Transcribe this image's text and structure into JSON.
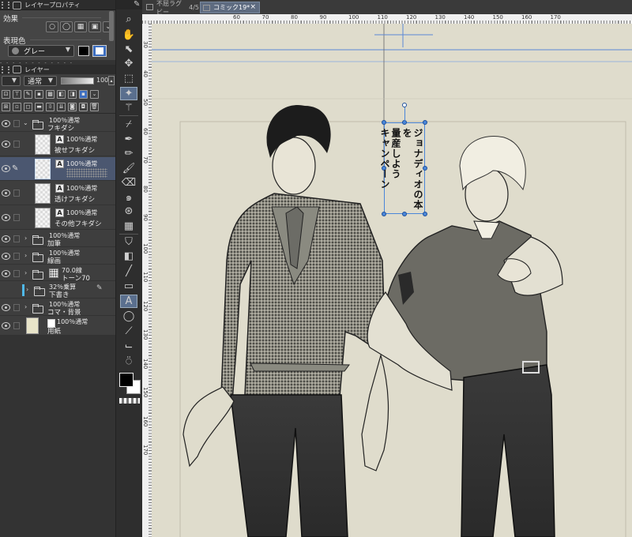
{
  "colors": {
    "accent": "#4a86d9",
    "canvas_bg": "#dfdccc",
    "panel_bg": "#3e3e3e",
    "selected_row": "#4b5770"
  },
  "property_panel": {
    "tab_title": "レイヤープロパティ",
    "effect_label": "効果",
    "expression_color_label": "表現色",
    "expression_color_value": "グレー"
  },
  "layer_panel": {
    "tab_title": "レイヤー",
    "blend_mode": "通常",
    "opacity": "100",
    "layers": [
      {
        "kind": "folder",
        "line1": "100％通常",
        "line2": "フキダシ",
        "expanded": true,
        "indent": 0
      },
      {
        "kind": "text",
        "line1": "100％通常",
        "line2": "被せフキダシ",
        "indent": 1
      },
      {
        "kind": "text",
        "line1": "100％通常",
        "line2": "",
        "indent": 1,
        "selected": true
      },
      {
        "kind": "text",
        "line1": "100％通常",
        "line2": "透けフキダシ",
        "indent": 1
      },
      {
        "kind": "text",
        "line1": "100％通常",
        "line2": "その他フキダシ",
        "indent": 1
      },
      {
        "kind": "folder",
        "line1": "100％通常",
        "line2": "加筆",
        "indent": 0
      },
      {
        "kind": "folder",
        "line1": "100％通常",
        "line2": "線画",
        "indent": 0
      },
      {
        "kind": "folder-tone",
        "line1": "70.0線",
        "line2": "トーン70",
        "indent": 0
      },
      {
        "kind": "folder",
        "line1": "32％乗算",
        "line2": "下書き",
        "indent": 0
      },
      {
        "kind": "folder",
        "line1": "100％通常",
        "line2": "コマ・背景",
        "indent": 0
      },
      {
        "kind": "paper",
        "line1": "100％通常",
        "line2": "用紙",
        "indent": 0
      }
    ]
  },
  "tabs": [
    {
      "label": "不屈ラグビー",
      "page": "4/5",
      "active": false
    },
    {
      "label": "コミック19*",
      "active": true
    }
  ],
  "ruler": {
    "h": [
      "60",
      "70",
      "80",
      "90",
      "100",
      "110",
      "120",
      "130",
      "140",
      "150",
      "160",
      "170"
    ],
    "v": [
      "30",
      "40",
      "50",
      "60",
      "70",
      "80",
      "90",
      "100",
      "110",
      "120",
      "130",
      "140",
      "150",
      "160",
      "170"
    ]
  },
  "canvas": {
    "balloon_text": [
      "ジョナディオの本を",
      "量産しよう",
      "キャンペーン"
    ]
  },
  "icons": {
    "close": "close-icon"
  }
}
